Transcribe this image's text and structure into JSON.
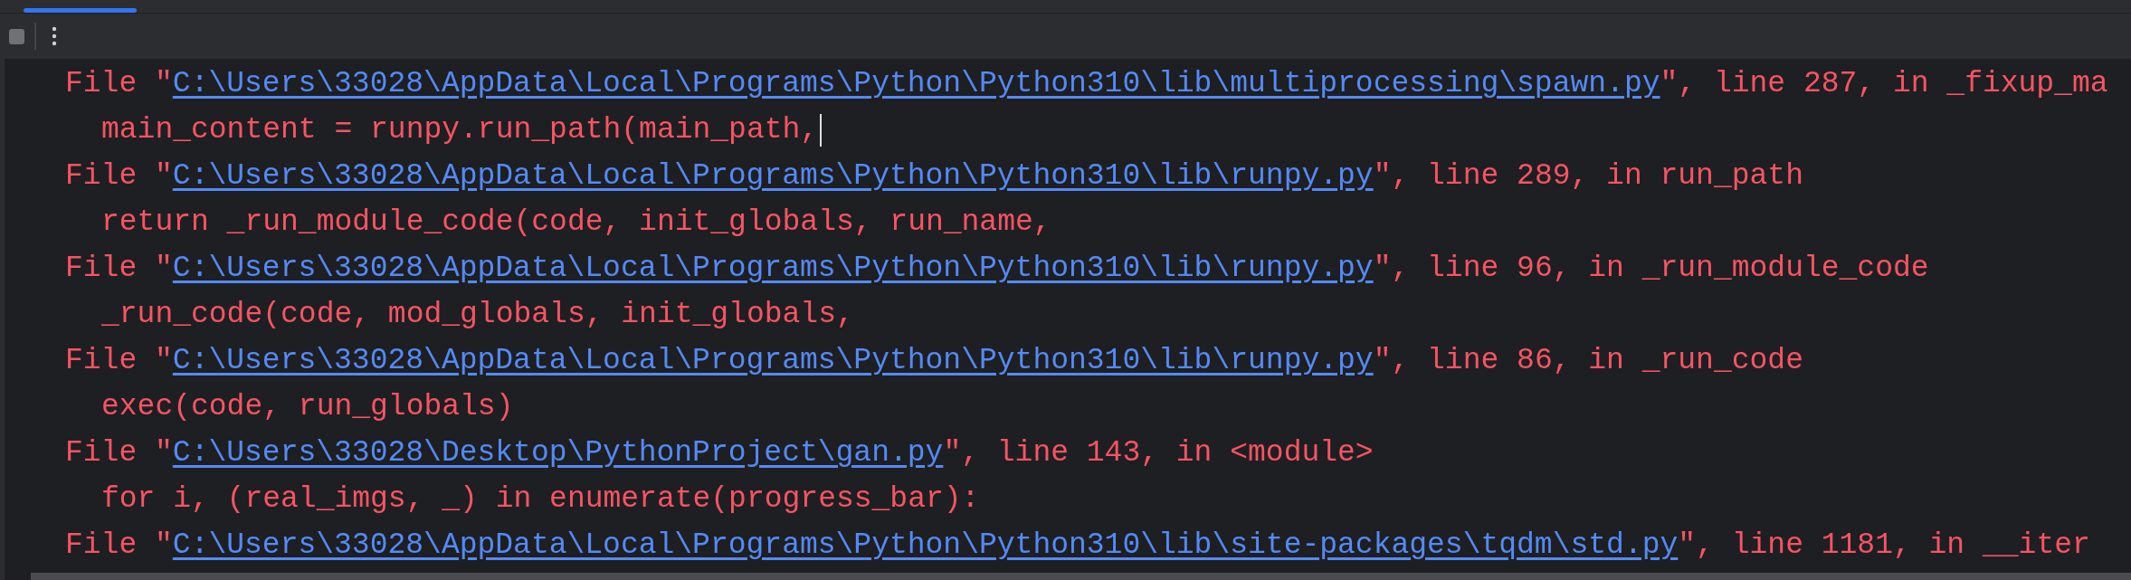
{
  "lines": [
    {
      "kind": "file",
      "prefix": "File \"",
      "path": "C:\\Users\\33028\\AppData\\Local\\Programs\\Python\\Python310\\lib\\multiprocessing\\spawn.py",
      "suffix": "\", line 287, in _fixup_ma"
    },
    {
      "kind": "code",
      "text": "main_content = runpy.run_path(main_path,",
      "cursor": true
    },
    {
      "kind": "file",
      "prefix": "File \"",
      "path": "C:\\Users\\33028\\AppData\\Local\\Programs\\Python\\Python310\\lib\\runpy.py",
      "suffix": "\", line 289, in run_path"
    },
    {
      "kind": "code",
      "text": "return _run_module_code(code, init_globals, run_name,",
      "cursor": false
    },
    {
      "kind": "file",
      "prefix": "File \"",
      "path": "C:\\Users\\33028\\AppData\\Local\\Programs\\Python\\Python310\\lib\\runpy.py",
      "suffix": "\", line 96, in _run_module_code"
    },
    {
      "kind": "code",
      "text": "_run_code(code, mod_globals, init_globals,",
      "cursor": false
    },
    {
      "kind": "file",
      "prefix": "File \"",
      "path": "C:\\Users\\33028\\AppData\\Local\\Programs\\Python\\Python310\\lib\\runpy.py",
      "suffix": "\", line 86, in _run_code"
    },
    {
      "kind": "code",
      "text": "exec(code, run_globals)",
      "cursor": false
    },
    {
      "kind": "file",
      "prefix": "File \"",
      "path": "C:\\Users\\33028\\Desktop\\PythonProject\\gan.py",
      "suffix": "\", line 143, in <module>"
    },
    {
      "kind": "code",
      "text": "for i, (real_imgs, _) in enumerate(progress_bar):",
      "cursor": false
    },
    {
      "kind": "file",
      "prefix": "File \"",
      "path": "C:\\Users\\33028\\AppData\\Local\\Programs\\Python\\Python310\\lib\\site-packages\\tqdm\\std.py",
      "suffix": "\", line 1181, in __iter"
    }
  ]
}
